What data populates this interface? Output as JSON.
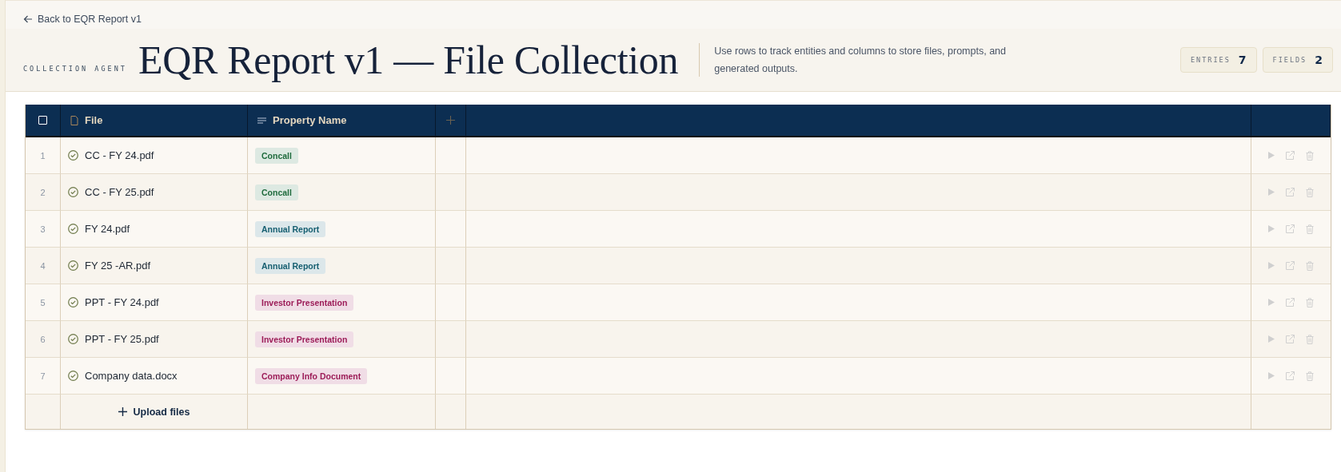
{
  "back_link": {
    "label": "Back to EQR Report v1"
  },
  "header": {
    "eyebrow": "COLLECTION AGENT",
    "title": "EQR Report v1 — File Collection",
    "description": "Use rows to track entities and columns to store files, prompts, and generated outputs.",
    "stats": [
      {
        "label": "ENTRIES",
        "value": "7"
      },
      {
        "label": "FIELDS",
        "value": "2"
      }
    ]
  },
  "table": {
    "select_all": {
      "checked": false
    },
    "columns": [
      {
        "kind": "file",
        "label": "File"
      },
      {
        "kind": "text",
        "label": "Property Name"
      }
    ],
    "rows": [
      {
        "number": "1",
        "file": "CC - FY 24.pdf",
        "property": {
          "label": "Concall",
          "color": "#1f6b3d"
        }
      },
      {
        "number": "2",
        "file": "CC - FY 25.pdf",
        "property": {
          "label": "Concall",
          "color": "#1f6b3d"
        }
      },
      {
        "number": "3",
        "file": "FY 24.pdf",
        "property": {
          "label": "Annual Report",
          "color": "#155e70"
        }
      },
      {
        "number": "4",
        "file": "FY 25 -AR.pdf",
        "property": {
          "label": "Annual Report",
          "color": "#155e70"
        }
      },
      {
        "number": "5",
        "file": "PPT - FY 24.pdf",
        "property": {
          "label": "Investor Presentation",
          "color": "#9c1c58"
        }
      },
      {
        "number": "6",
        "file": "PPT - FY 25.pdf",
        "property": {
          "label": "Investor Presentation",
          "color": "#9c1c58"
        }
      },
      {
        "number": "7",
        "file": "Company data.docx",
        "property": {
          "label": "Company Info Document",
          "color": "#9c1c58"
        }
      }
    ],
    "upload": {
      "label": "Upload files"
    }
  }
}
